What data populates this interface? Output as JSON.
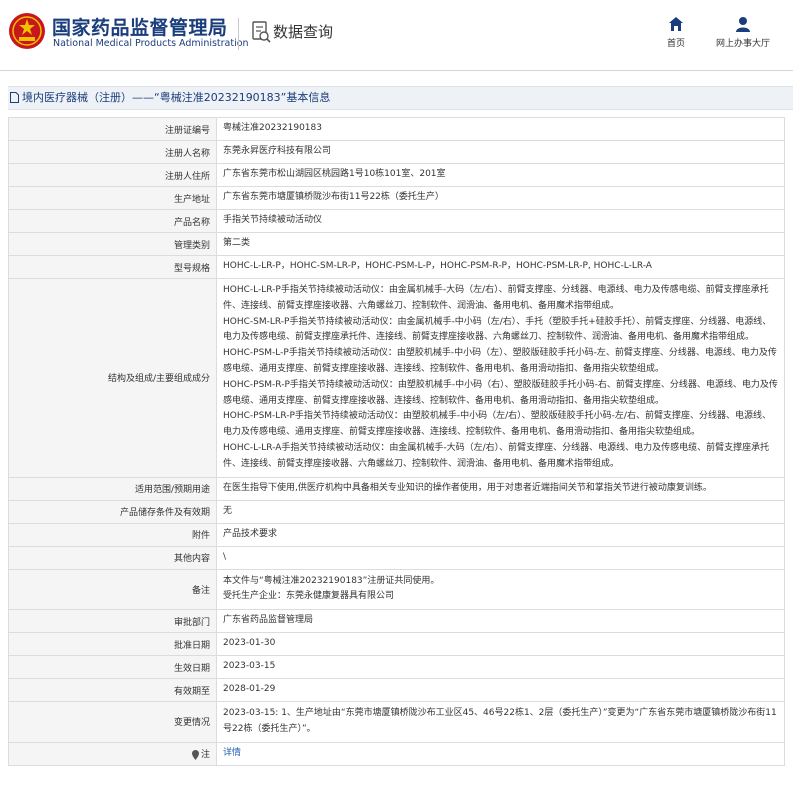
{
  "header": {
    "site_title_cn": "国家药品监督管理局",
    "site_title_en": "National Medical Products Administration",
    "query_title": "数据查询",
    "nav": [
      {
        "label": "首页",
        "icon": "home-icon"
      },
      {
        "label": "网上办事大厅",
        "icon": "user-icon"
      }
    ]
  },
  "breadcrumb": {
    "text": "境内医疗器械（注册）——“粤械注准20232190183”基本信息"
  },
  "rows": [
    {
      "label": "注册证编号",
      "value": "粤械注准20232190183"
    },
    {
      "label": "注册人名称",
      "value": "东莞永昇医疗科技有限公司"
    },
    {
      "label": "注册人住所",
      "value": "广东省东莞市松山湖园区桃园路1号10栋101室、201室"
    },
    {
      "label": "生产地址",
      "value": "广东省东莞市塘厦镇桥陇沙布街11号22栋（委托生产）"
    },
    {
      "label": "产品名称",
      "value": "手指关节持续被动活动仪"
    },
    {
      "label": "管理类别",
      "value": "第二类"
    },
    {
      "label": "型号规格",
      "value": "HOHC-L-LR-P，HOHC-SM-LR-P，HOHC-PSM-L-P，HOHC-PSM-R-P，HOHC-PSM-LR-P, HOHC-L-LR-A"
    },
    {
      "label": "结构及组成/主要组成成分",
      "value": "HOHC-L-LR-P手指关节持续被动活动仪：由金属机械手-大码（左/右）、前臂支撑座、分线器、电源线、电力及传感电缆、前臂支撑座承托件、连接线、前臂支撑座接收器、六角螺丝刀、控制软件、润滑油、备用电机、备用魔术指带组成。\nHOHC-SM-LR-P手指关节持续被动活动仪：由金属机械手-中小码（左/右）、手托（塑胶手托+硅胶手托）、前臂支撑座、分线器、电源线、电力及传感电缆、前臂支撑座承托件、连接线、前臂支撑座接收器、六角螺丝刀、控制软件、润滑油、备用电机、备用魔术指带组成。\nHOHC-PSM-L-P手指关节持续被动活动仪：由塑胶机械手-中小码（左）、塑胶版硅胶手托小码-左、前臂支撑座、分线器、电源线、电力及传感电缆、通用支撑座、前臂支撑座接收器、连接线、控制软件、备用电机、备用滑动指扣、备用指尖软垫组成。\nHOHC-PSM-R-P手指关节持续被动活动仪：由塑胶机械手-中小码（右）、塑胶版硅胶手托小码-右、前臂支撑座、分线器、电源线、电力及传感电缆、通用支撑座、前臂支撑座接收器、连接线、控制软件、备用电机、备用滑动指扣、备用指尖软垫组成。\nHOHC-PSM-LR-P手指关节持续被动活动仪：由塑胶机械手-中小码（左/右）、塑胶版硅胶手托小码-左/右、前臂支撑座、分线器、电源线、电力及传感电缆、通用支撑座、前臂支撑座接收器、连接线、控制软件、备用电机、备用滑动指扣、备用指尖软垫组成。\nHOHC-L-LR-A手指关节持续被动活动仪：由金属机械手-大码（左/右）、前臂支撑座、分线器、电源线、电力及传感电缆、前臂支撑座承托件、连接线、前臂支撑座接收器、六角螺丝刀、控制软件、润滑油、备用电机、备用魔术指带组成。",
      "tall": true
    },
    {
      "label": "适用范围/预期用途",
      "value": "在医生指导下使用,供医疗机构中具备相关专业知识的操作者使用，用于对患者近端指间关节和掌指关节进行被动康复训练。"
    },
    {
      "label": "产品储存条件及有效期",
      "value": "无"
    },
    {
      "label": "附件",
      "value": "产品技术要求"
    },
    {
      "label": "其他内容",
      "value": "\\"
    },
    {
      "label": "备注",
      "value": "本文件与“粤械注准20232190183”注册证共同使用。\n受托生产企业：东莞永健康复器具有限公司",
      "tall": true
    },
    {
      "label": "审批部门",
      "value": "广东省药品监督管理局"
    },
    {
      "label": "批准日期",
      "value": "2023-01-30"
    },
    {
      "label": "生效日期",
      "value": "2023-03-15"
    },
    {
      "label": "有效期至",
      "value": "2028-01-29"
    },
    {
      "label": "变更情况",
      "value": "2023-03-15: 1、生产地址由“东莞市塘厦镇桥陇沙布工业区45、46号22栋1、2层（委托生产）”变更为“广东省东莞市塘厦镇桥陇沙布街11号22栋（委托生产）”。",
      "tall": true
    },
    {
      "label": "注",
      "value": "详情",
      "link": true,
      "label_icon": "location-pin-icon"
    }
  ]
}
